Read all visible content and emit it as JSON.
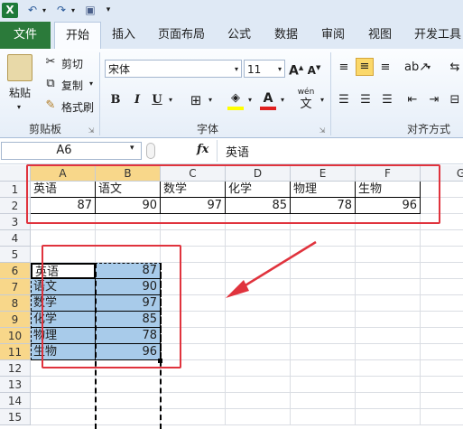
{
  "qat": {
    "icons": [
      "excel-logo-icon",
      "undo-icon",
      "redo-icon",
      "save-icon",
      "customize-icon"
    ]
  },
  "tabs": [
    {
      "label": "文件",
      "key": "file"
    },
    {
      "label": "开始",
      "key": "home"
    },
    {
      "label": "插入",
      "key": "insert"
    },
    {
      "label": "页面布局",
      "key": "layout"
    },
    {
      "label": "公式",
      "key": "formulas"
    },
    {
      "label": "数据",
      "key": "data"
    },
    {
      "label": "审阅",
      "key": "review"
    },
    {
      "label": "视图",
      "key": "view"
    },
    {
      "label": "开发工具",
      "key": "developer"
    }
  ],
  "ribbon": {
    "clipboard": {
      "paste": "粘贴",
      "cut": "剪切",
      "copy": "复制",
      "format_painter": "格式刷",
      "label": "剪贴板"
    },
    "font": {
      "name": "宋体",
      "size": "11",
      "grow": "A",
      "shrink": "A",
      "bold": "B",
      "italic": "I",
      "underline": "U",
      "wen": "wén",
      "wen_char": "文",
      "label": "字体"
    },
    "align": {
      "label": "对齐方式"
    }
  },
  "formula_bar": {
    "name_box": "A6",
    "fx": "fx",
    "formula": "英语"
  },
  "columns": [
    "A",
    "B",
    "C",
    "D",
    "E",
    "F",
    "G"
  ],
  "rows": [
    "1",
    "2",
    "3",
    "4",
    "5",
    "6",
    "7",
    "8",
    "9",
    "10",
    "11",
    "12",
    "13",
    "14",
    "15"
  ],
  "table1": {
    "headers": [
      "英语",
      "语文",
      "数学",
      "化学",
      "物理",
      "生物"
    ],
    "values": [
      "87",
      "90",
      "97",
      "85",
      "78",
      "96"
    ]
  },
  "table2": [
    {
      "subject": "英语",
      "score": "87"
    },
    {
      "subject": "语文",
      "score": "90"
    },
    {
      "subject": "数学",
      "score": "97"
    },
    {
      "subject": "化学",
      "score": "85"
    },
    {
      "subject": "物理",
      "score": "78"
    },
    {
      "subject": "生物",
      "score": "96"
    }
  ],
  "colors": {
    "annotation": "#e0333d",
    "selection": "#a8cbea",
    "file_tab": "#2b7a3a",
    "header_selected": "#f8d78a"
  }
}
